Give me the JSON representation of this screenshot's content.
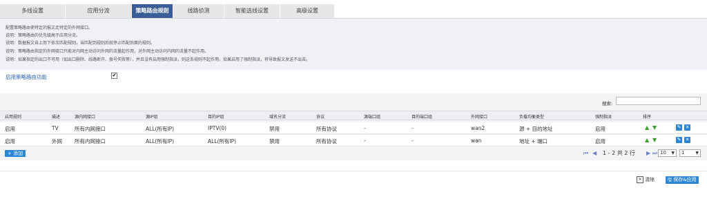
{
  "tabs": [
    {
      "label": "多线设置"
    },
    {
      "label": "应用分流"
    },
    {
      "label": "策略路由规则"
    },
    {
      "label": "线路侦测"
    },
    {
      "label": "智能选线设置"
    },
    {
      "label": "高级设置"
    }
  ],
  "description": [
    "配置策略路由使特定的报文走特定的外网接口。",
    "说明：策略路由的优先级高于应用分流。",
    "说明：数据报文自上而下依次匹配规则，当匹配到规则后就停止匹配后面的规则。",
    "说明：策略路由指定的外网接口只能对内网主动访问外网的流量起作用，对外网主动访问内网的流量不起作用。",
    "说明：如果指定的出口不可用（如出口删除、线路断开、拨号失败等），并且没有启用强制指派，则这条规则不起作用，如果启用了强制指派，将导致报文发送不出去。"
  ],
  "enable": {
    "label": "启用策略路由功能",
    "checked": "✔"
  },
  "search": {
    "label": "搜索:",
    "value": ""
  },
  "table": {
    "headers": [
      "启用规则",
      "描述",
      "源内网接口",
      "源IP组",
      "目的IP组",
      "域名分流",
      "协议",
      "源端口组",
      "目的端口组",
      "外网接口",
      "负载均衡类型",
      "强制指派",
      "排序"
    ],
    "rows": [
      {
        "enabled": "启用",
        "desc": "TV",
        "src_if": "所有内网接口",
        "src_ip": "ALL(所有IP)",
        "dst_ip": "IPTV(0)",
        "domain": "禁用",
        "proto": "所有协议",
        "src_port": "-",
        "dst_port": "-",
        "wan": "wan2",
        "lb": "源 + 目的地址",
        "force": "启用"
      },
      {
        "enabled": "启用",
        "desc": "外网",
        "src_if": "所有内网接口",
        "src_ip": "ALL(所有IP)",
        "dst_ip": "ALL(所有IP)",
        "domain": "禁用",
        "proto": "所有协议",
        "src_port": "-",
        "dst_port": "-",
        "wan": "wan",
        "lb": "地址 + 端口",
        "force": "启用"
      }
    ]
  },
  "footer": {
    "add_label": "添加",
    "add_icon": "+",
    "pager_text": "1 - 2 共 2 行",
    "page_size": "10",
    "page_number": "1"
  },
  "actions": {
    "clear_label": "清除",
    "save_label": "保存&应用"
  },
  "colors": {
    "accent": "#2b86d6",
    "active_tab": "#3b5e98",
    "sort_green": "#3c9a2c"
  }
}
